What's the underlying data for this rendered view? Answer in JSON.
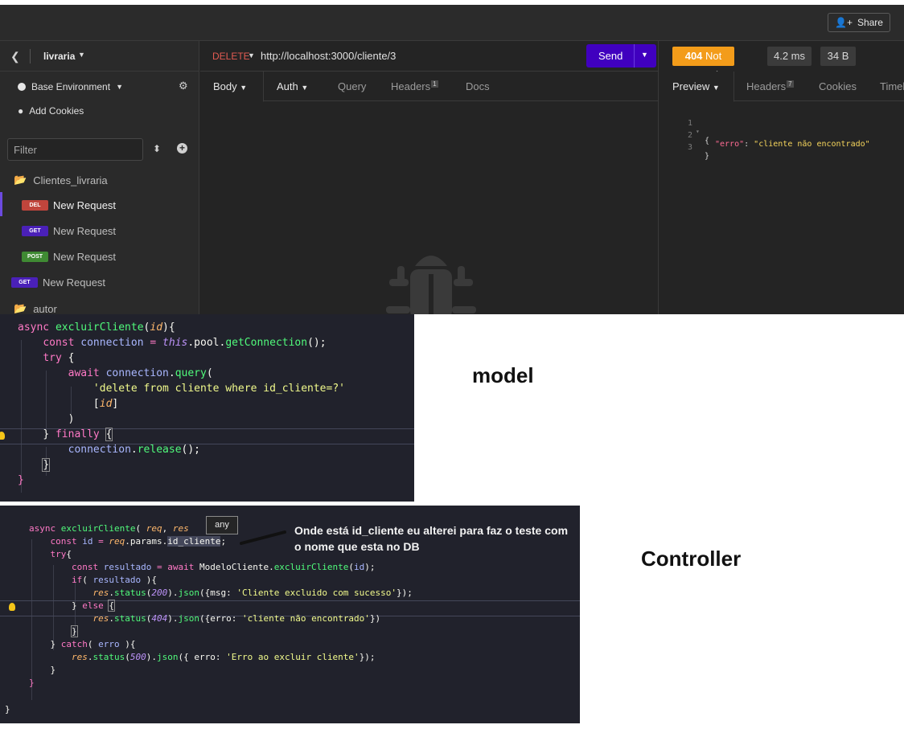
{
  "window": {
    "share_label": "Share"
  },
  "sidebar": {
    "workspace": "livraria",
    "environment": "Base Environment",
    "add_cookies": "Add Cookies",
    "filter_placeholder": "Filter",
    "items": [
      {
        "kind": "folder",
        "label": "Clientes_livraria"
      },
      {
        "kind": "request",
        "method": "DEL",
        "label": "New Request",
        "color": "#c0453c"
      },
      {
        "kind": "request",
        "method": "GET",
        "label": "New Request",
        "color": "#4a20b8"
      },
      {
        "kind": "request",
        "method": "POST",
        "label": "New Request",
        "color": "#3f8a33"
      },
      {
        "kind": "request",
        "method": "GET",
        "label": "New Request",
        "color": "#4a20b8"
      },
      {
        "kind": "folder",
        "label": "autor"
      }
    ]
  },
  "request": {
    "method": "DELETE",
    "url": "http://localhost:3000/cliente/3",
    "send_label": "Send",
    "tabs": {
      "body": "Body",
      "auth": "Auth",
      "query": "Query",
      "headers": "Headers",
      "headers_count": "1",
      "docs": "Docs"
    }
  },
  "response": {
    "status_code": "404",
    "status_text": "Not Found",
    "time": "4.2 ms",
    "size": "34 B",
    "tabs": {
      "preview": "Preview",
      "headers": "Headers",
      "headers_count": "7",
      "cookies": "Cookies",
      "timeline": "Timeline"
    },
    "json_lines": [
      {
        "num": "1",
        "open": "{"
      },
      {
        "num": "2",
        "key": "\"erro\"",
        "value": "\"cliente não encontrado\""
      },
      {
        "num": "3",
        "close": "}"
      }
    ]
  },
  "model_code": {
    "l1_kw": "async",
    "l1_fn": "excluirCliente",
    "l1_p": "id",
    "l2_kw": "const",
    "l2_var": "connection",
    "l2_this": "this",
    "l2_rest": ".pool.",
    "l2_fn": "getConnection",
    "l3_kw": "try",
    "l4_kw": "await",
    "l4_var": "connection",
    "l4_fn": "query",
    "l5_str": "'delete from cliente where id_cliente=?'",
    "l6_p": "id",
    "l8_kw": "finally",
    "l9_var": "connection",
    "l9_fn": "release"
  },
  "controller_code": {
    "l1_kw": "async",
    "l1_fn": "excluirCliente",
    "l1_p1": "req",
    "l1_p2": "res",
    "l2_kw": "const",
    "l2_var": "id",
    "l2_p": "req",
    "l2_rest": ".params.",
    "l2_prop": "id_cliente",
    "l3_kw": "try",
    "l4_kw": "const",
    "l4_var": "resultado",
    "l4_kw2": "await",
    "l4_obj": "ModeloCliente",
    "l4_fn": "excluirCliente",
    "l4_arg": "id",
    "l5_kw": "if",
    "l5_var": "resultado",
    "l6_p": "res",
    "l6_fn1": "status",
    "l6_num": "200",
    "l6_fn2": "json",
    "l6_key": "msg",
    "l6_str": "'Cliente excluido com sucesso'",
    "l7_kw": "else",
    "l8_p": "res",
    "l8_fn1": "status",
    "l8_num": "404",
    "l8_fn2": "json",
    "l8_key": "erro",
    "l8_str": "'cliente não encontrado'",
    "l10_kw": "catch",
    "l10_var": "erro",
    "l11_p": "res",
    "l11_fn1": "status",
    "l11_num": "500",
    "l11_fn2": "json",
    "l11_key": "erro",
    "l11_str": "'Erro ao excluir cliente'"
  },
  "tooltip": "any",
  "annotation": "Onde está id_cliente eu alterei para faz o teste com o nome que esta no DB",
  "labels": {
    "model": "model",
    "controller": "Controller"
  }
}
